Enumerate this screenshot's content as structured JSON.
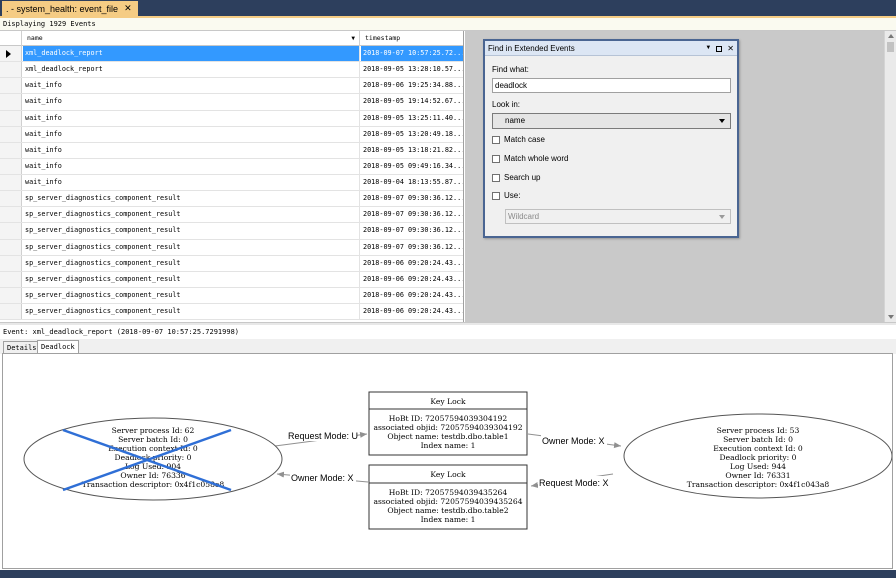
{
  "tab": {
    "title": ". - system_health: event_file",
    "close_glyph": "✕"
  },
  "status_text": "Displaying 1929 Events",
  "grid": {
    "columns": [
      "name",
      "timestamp"
    ],
    "rows": [
      [
        "xml_deadlock_report",
        "2018-09-07 10:57:25.72..."
      ],
      [
        "xml_deadlock_report",
        "2018-09-05 13:28:10.57..."
      ],
      [
        "wait_info",
        "2018-09-06 19:25:34.88..."
      ],
      [
        "wait_info",
        "2018-09-05 19:14:52.67..."
      ],
      [
        "wait_info",
        "2018-09-05 13:25:11.40..."
      ],
      [
        "wait_info",
        "2018-09-05 13:20:49.18..."
      ],
      [
        "wait_info",
        "2018-09-05 13:18:21.82..."
      ],
      [
        "wait_info",
        "2018-09-05 09:49:16.34..."
      ],
      [
        "wait_info",
        "2018-09-04 18:13:55.87..."
      ],
      [
        "sp_server_diagnostics_component_result",
        "2018-09-07 09:30:36.12..."
      ],
      [
        "sp_server_diagnostics_component_result",
        "2018-09-07 09:30:36.12..."
      ],
      [
        "sp_server_diagnostics_component_result",
        "2018-09-07 09:30:36.12..."
      ],
      [
        "sp_server_diagnostics_component_result",
        "2018-09-07 09:30:36.12..."
      ],
      [
        "sp_server_diagnostics_component_result",
        "2018-09-06 09:20:24.43..."
      ],
      [
        "sp_server_diagnostics_component_result",
        "2018-09-06 09:20:24.43..."
      ],
      [
        "sp_server_diagnostics_component_result",
        "2018-09-06 09:20:24.43..."
      ],
      [
        "sp_server_diagnostics_component_result",
        "2018-09-06 09:20:24.43..."
      ]
    ],
    "selected_row": 0,
    "selection_color": "#3399ff"
  },
  "find_dialog": {
    "title": "Find in Extended Events",
    "find_what_label": "Find what:",
    "find_what_value": "deadlock",
    "look_in_label": "Look in:",
    "look_in_value": "name",
    "match_case_label": "Match case",
    "match_whole_word_label": "Match whole word",
    "search_up_label": "Search up",
    "use_label": "Use:",
    "use_value": "Wildcard",
    "checked": {
      "match_case": false,
      "match_whole_word": false,
      "search_up": false,
      "use": false
    }
  },
  "event_line": "Event: xml_deadlock_report (2018-09-07 10:57:25.7291998)",
  "subtabs": [
    "Details",
    "Deadlock"
  ],
  "active_subtab": "Deadlock",
  "deadlock": {
    "victim": {
      "lines": [
        "Server process Id: 62",
        "Server batch Id: 0",
        "Execution context Id: 0",
        "Deadlock priority: 0",
        "Log Used: 904",
        "Owner Id: 76336",
        "Transaction descriptor: 0x4f1c058e8"
      ],
      "is_victim": true
    },
    "survivor": {
      "lines": [
        "Server process Id: 53",
        "Server batch Id: 0",
        "Execution context Id: 0",
        "Deadlock priority: 0",
        "Log Used: 944",
        "Owner Id: 76331",
        "Transaction descriptor: 0x4f1c043a8"
      ]
    },
    "locks": [
      {
        "title": "Key Lock",
        "lines": [
          "HoBt ID: 72057594039304192",
          "associated objid: 72057594039304192",
          "Object name: testdb.dbo.table1",
          "Index name: 1"
        ]
      },
      {
        "title": "Key Lock",
        "lines": [
          "HoBt ID: 72057594039435264",
          "associated objid: 72057594039435264",
          "Object name: testdb.dbo.table2",
          "Index name: 1"
        ]
      }
    ],
    "edges": {
      "request_u": "Request Mode: U",
      "owner_x_1": "Owner Mode: X",
      "owner_x_2": "Owner Mode: X",
      "request_x": "Request Mode: X"
    },
    "victim_cross_color": "#2f6fd6"
  },
  "colors": {
    "chrome_dark": "#2d3f5d",
    "tab_gold": "#f5cc84",
    "dialog_border": "#4a6592"
  }
}
